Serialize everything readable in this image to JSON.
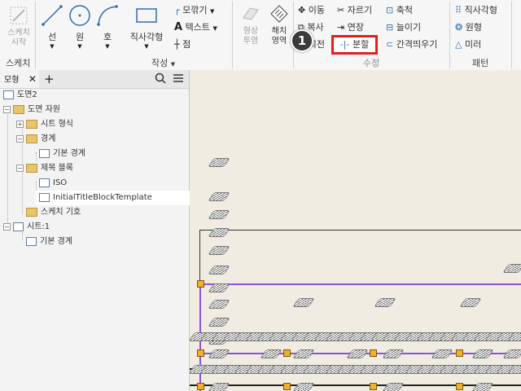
{
  "ribbon": {
    "sketch_start": {
      "line1": "스케치",
      "line2": "시작"
    },
    "sketch_panel_label": "스케치",
    "create": {
      "line": "선",
      "circle": "원",
      "arc": "호",
      "rectangle": "직사각형",
      "fillet": "모깎기",
      "text": "텍스트",
      "point": "점",
      "panel_label": "작성"
    },
    "format": {
      "shape_line1": "형상",
      "shape_line2": "투영",
      "hatch_line1": "해치",
      "hatch_line2": "영역"
    },
    "modify": {
      "move": "이동",
      "copy": "복사",
      "rotate": "회전",
      "trim": "자르기",
      "extend": "연장",
      "split": "분할",
      "scale": "축척",
      "stretch": "늘이기",
      "offset": "간격띄우기",
      "panel_label": "수정"
    },
    "pattern": {
      "rectangular": "직사각형",
      "circular": "원형",
      "mirror": "미러",
      "panel_label": "패턴"
    },
    "callout_number": "1"
  },
  "browser": {
    "tab_label": "모형",
    "tree": [
      {
        "label": "도면2"
      },
      {
        "label": "도면 자원"
      },
      {
        "label": "시트 형식"
      },
      {
        "label": "경계"
      },
      {
        "label": "기본 경계"
      },
      {
        "label": "제목 블록"
      },
      {
        "label": "ISO"
      },
      {
        "label": "InitialTitleBlockTemplate"
      },
      {
        "label": "스케치 기호"
      },
      {
        "label": "시트:1"
      },
      {
        "label": "기본 경계"
      }
    ]
  },
  "colors": {
    "highlight_box": "#e01f1f",
    "callout_bg": "#3b3b3b",
    "grip": "#f2b124",
    "border_line": "#8a55d6",
    "canvas_bg": "#f0ece2"
  }
}
